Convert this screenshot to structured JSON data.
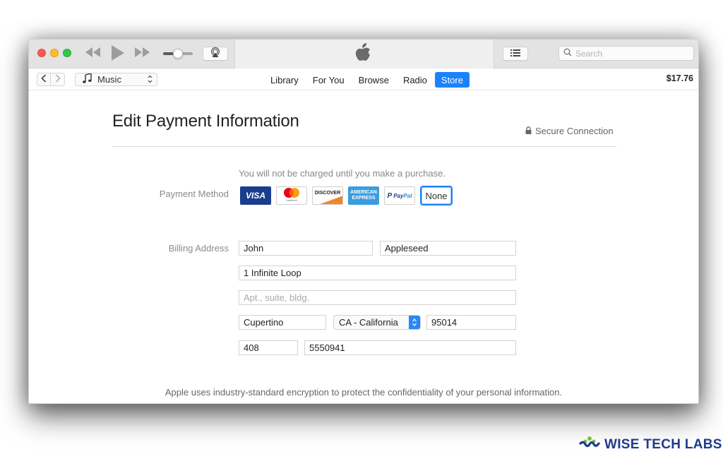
{
  "toolbar": {
    "search_placeholder": "Search",
    "icons": {
      "rewind": "rewind-icon",
      "play": "play-icon",
      "fast_forward": "fast-forward-icon",
      "airplay": "airplay-icon",
      "apple_logo": "apple-logo-icon",
      "list": "list-icon",
      "search": "search-icon"
    },
    "volume_level": 0.45
  },
  "navbar": {
    "media_type": "Music",
    "tabs": [
      {
        "label": "Library",
        "active": false
      },
      {
        "label": "For You",
        "active": false
      },
      {
        "label": "Browse",
        "active": false
      },
      {
        "label": "Radio",
        "active": false
      },
      {
        "label": "Store",
        "active": true
      }
    ],
    "account_balance": "$17.76"
  },
  "page": {
    "title": "Edit Payment Information",
    "secure_label": "Secure Connection",
    "charge_note": "You will not be charged until you make a purchase.",
    "payment_method": {
      "label": "Payment Method",
      "options": [
        {
          "name": "Visa",
          "text": "VISA",
          "selected": false
        },
        {
          "name": "Mastercard",
          "text": "mastercard",
          "selected": false
        },
        {
          "name": "Discover",
          "text": "DISCOVER",
          "selected": false
        },
        {
          "name": "American Express",
          "text_line1": "AMERICAN",
          "text_line2": "EXPRESS",
          "selected": false
        },
        {
          "name": "PayPal",
          "text1": "Pay",
          "text2": "Pal",
          "selected": false
        },
        {
          "name": "None",
          "text": "None",
          "selected": true
        }
      ]
    },
    "billing_address": {
      "label": "Billing Address",
      "first_name": "John",
      "last_name": "Appleseed",
      "street": "1 Infinite Loop",
      "apt_value": "",
      "apt_placeholder": "Apt., suite, bldg.",
      "city": "Cupertino",
      "state": "CA - California",
      "zip": "95014",
      "area_code": "408",
      "phone": "5550941"
    },
    "footer_note": "Apple uses industry-standard encryption to protect the confidentiality of your personal information."
  },
  "colors": {
    "accent": "#1a82fb",
    "visa": "#1a3e8c",
    "amex": "#3b9ce0",
    "discover_orange": "#f0852a"
  },
  "watermark": {
    "text": "WISE TECH LABS"
  }
}
